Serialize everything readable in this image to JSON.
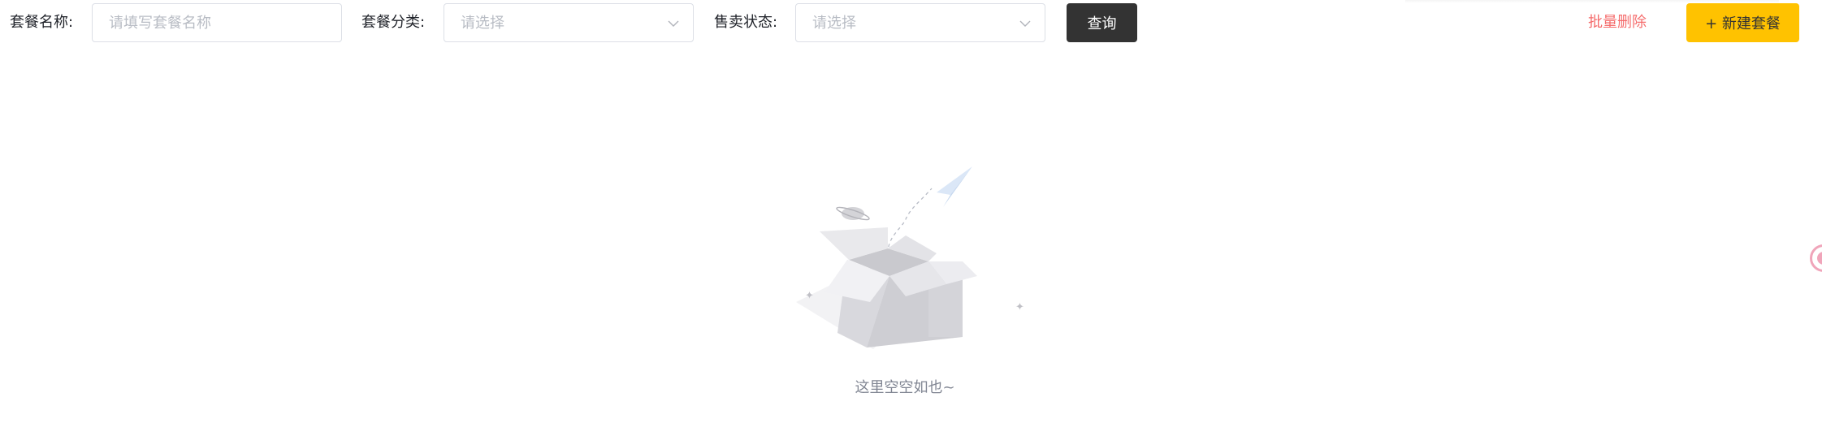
{
  "filters": {
    "name_label": "套餐名称:",
    "name_placeholder": "请填写套餐名称",
    "category_label": "套餐分类:",
    "category_placeholder": "请选择",
    "status_label": "售卖状态:",
    "status_placeholder": "请选择"
  },
  "actions": {
    "query_label": "查询",
    "batch_delete_label": "批量删除",
    "new_label": "+ 新建套餐"
  },
  "empty_state": {
    "text": "这里空空如也~",
    "icon": "empty-box-icon"
  },
  "colors": {
    "query_button": "#333333",
    "new_button": "#ffc200",
    "batch_delete_text": "#f56c6c",
    "placeholder": "#b8bcc4",
    "empty_text": "#818693"
  },
  "icons": {
    "select_arrow": "chevron-down-icon",
    "floating_widget": "floating-assistant-icon"
  }
}
